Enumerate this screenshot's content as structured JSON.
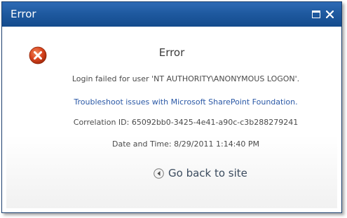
{
  "window": {
    "title": "Error",
    "maximize_icon": "maximize-icon",
    "close_icon": "close-icon",
    "help_icon": "help-icon",
    "help_glyph": "?"
  },
  "error": {
    "icon": "error-x-icon",
    "heading": "Error",
    "message": "Login failed for user 'NT AUTHORITY\\ANONYMOUS LOGON'.",
    "troubleshoot_link": "Troubleshoot issues with Microsoft SharePoint Foundation.",
    "correlation": "Correlation ID: 65092bb0-3425-4e41-a90c-c3b288279241",
    "datetime": "Date and Time: 8/29/2011 1:14:40 PM",
    "back_link": "Go back to site",
    "back_icon": "back-arrow-icon"
  },
  "colors": {
    "titlebar": "#1f5aa0",
    "link": "#2a58a6",
    "error_icon": "#d9441f"
  }
}
